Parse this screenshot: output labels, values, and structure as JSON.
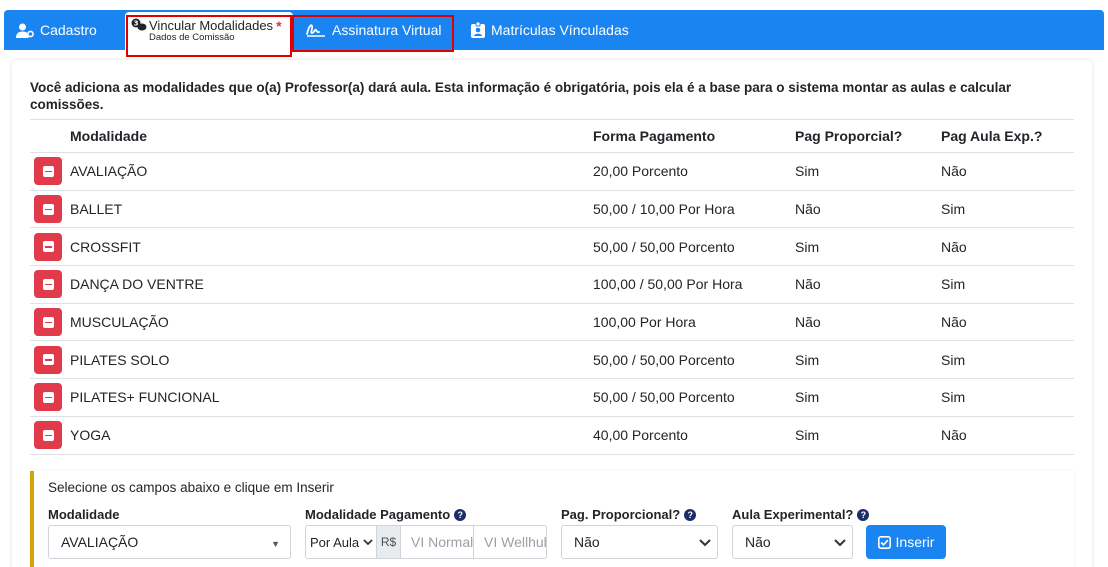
{
  "tabs": {
    "cadastro": "Cadastro",
    "vincular_main": "Vincular Modalidades",
    "vincular_sub": "Dados de Comissão",
    "vincular_required": "*",
    "assinatura": "Assinatura Virtual",
    "matriculas": "Matrículas Vínculadas"
  },
  "intro": "Você adiciona as modalidades que o(a) Professor(a) dará aula. Esta informação é obrigatória, pois ela é a base para o sistema montar as aulas e calcular comissões.",
  "table": {
    "headers": [
      "Modalidade",
      "Forma Pagamento",
      "Pag Proporcial?",
      "Pag Aula Exp.?"
    ],
    "rows": [
      [
        "AVALIAÇÃO",
        "20,00 Porcento",
        "Sim",
        "Não"
      ],
      [
        "BALLET",
        "50,00 / 10,00 Por Hora",
        "Não",
        "Sim"
      ],
      [
        "CROSSFIT",
        "50,00 / 50,00 Porcento",
        "Sim",
        "Não"
      ],
      [
        "DANÇA DO VENTRE",
        "100,00 / 50,00 Por Hora",
        "Não",
        "Sim"
      ],
      [
        "MUSCULAÇÃO",
        "100,00 Por Hora",
        "Não",
        "Não"
      ],
      [
        "PILATES SOLO",
        "50,00 / 50,00 Porcento",
        "Sim",
        "Sim"
      ],
      [
        "PILATES+ FUNCIONAL",
        "50,00 / 50,00 Porcento",
        "Sim",
        "Sim"
      ],
      [
        "YOGA",
        "40,00 Porcento",
        "Sim",
        "Não"
      ]
    ]
  },
  "form": {
    "title": "Selecione os campos abaixo e clique em Inserir",
    "modalidade_label": "Modalidade",
    "modalidade_value": "AVALIAÇÃO",
    "pagamento_label": "Modalidade Pagamento",
    "pagamento_select": "Por Aula",
    "currency": "R$",
    "vl_normal_placeholder": "VI Normal",
    "vl_wellhub_placeholder": "VI Wellhub",
    "proporcional_label": "Pag. Proporcional?",
    "proporcional_value": "Não",
    "experimental_label": "Aula Experimental?",
    "experimental_value": "Não",
    "help_glyph": "?",
    "insert_label": "Inserir"
  },
  "colors": {
    "tabbar": "#1a85f0",
    "delete": "#e03a4b",
    "highlight": "#e00000",
    "panel_accent": "#d4a406"
  }
}
